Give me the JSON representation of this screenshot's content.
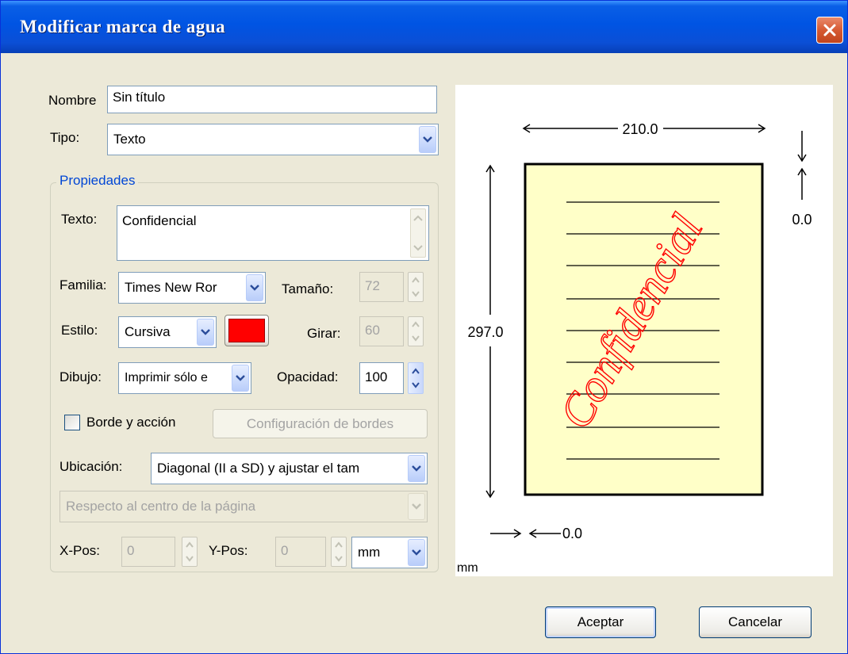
{
  "window": {
    "title": "Modificar marca de agua",
    "close_icon": "close-icon"
  },
  "form": {
    "name_label": "Nombre",
    "name_value": "Sin título",
    "type_label": "Tipo:",
    "type_value": "Texto"
  },
  "properties": {
    "group_label": "Propiedades",
    "text_label": "Texto:",
    "text_value": "Confidencial",
    "family_label": "Familia:",
    "family_value": "Times New Ror",
    "size_label": "Tamaño:",
    "size_value": "72",
    "style_label": "Estilo:",
    "style_value": "Cursiva",
    "color": "#ff0000",
    "rotate_label": "Girar:",
    "rotate_value": "60",
    "drawing_label": "Dibujo:",
    "drawing_value": "Imprimir sólo e",
    "opacity_label": "Opacidad:",
    "opacity_value": "100",
    "border_checkbox_label": "Borde y acción",
    "border_checked": false,
    "border_settings_button": "Configuración de bordes",
    "location_label": "Ubicación:",
    "location_value": "Diagonal (II a SD) y ajustar el tam",
    "relative_value": "Respecto al centro de la página",
    "xpos_label": "X-Pos:",
    "xpos_value": "0",
    "ypos_label": "Y-Pos:",
    "ypos_value": "0",
    "unit_value": "mm"
  },
  "preview": {
    "width_label": "210.0",
    "height_label": "297.0",
    "top_margin_label": "0.0",
    "left_margin_label": "0.0",
    "unit_label": "mm",
    "watermark_text": "Confidencial",
    "page_color": "#ffffc8",
    "watermark_color": "#ff0000"
  },
  "buttons": {
    "ok": "Aceptar",
    "cancel": "Cancelar"
  }
}
